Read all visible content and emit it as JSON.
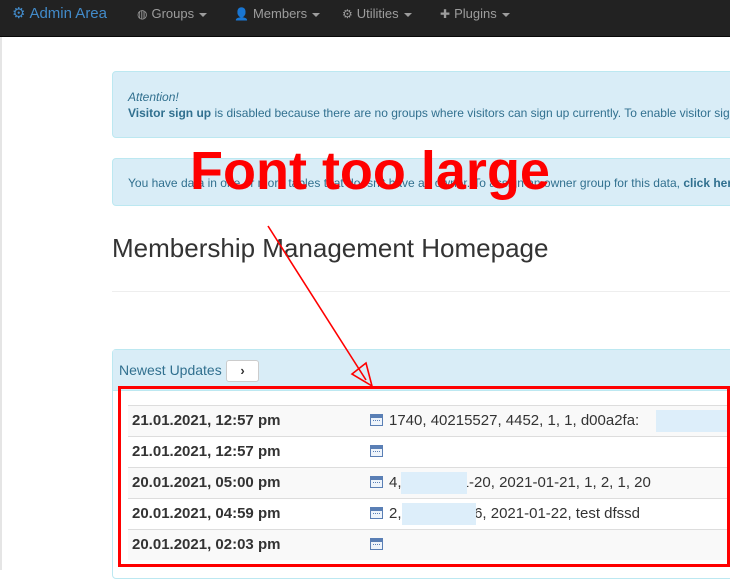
{
  "navbar": {
    "brand": "Admin Area",
    "items": [
      {
        "label": "Groups",
        "icon": "globe-icon"
      },
      {
        "label": "Members",
        "icon": "user-icon"
      },
      {
        "label": "Utilities",
        "icon": "cog-icon"
      },
      {
        "label": "Plugins",
        "icon": "plus-icon"
      }
    ]
  },
  "alerts": {
    "signup": {
      "heading": "Attention!",
      "bold": "Visitor sign up",
      "text": " is disabled because there are no groups where visitors can sign up currently. To enable visitor sig"
    },
    "ownerless": {
      "text": "You have data in one or more tables that doesn't have an owner. To assign an owner group for this data, ",
      "link": "click her"
    }
  },
  "page": {
    "title": "Membership Management Homepage"
  },
  "panel": {
    "title": "Newest Updates",
    "button_glyph": "›",
    "rows": [
      {
        "date": "21.01.2021, 12:57 pm",
        "text": "1740, 40215527, 4452, 1, 1, d00a2fa:"
      },
      {
        "date": "21.01.2021, 12:57 pm",
        "text": ""
      },
      {
        "date": "20.01.2021, 05:00 pm",
        "text": "4,              , 2021-01-20, 2021-01-21, 1, 2, 1, 20"
      },
      {
        "date": "20.01.2021, 04:59 pm",
        "text": "2,                 2021-01-16, 2021-01-22, test dfssd"
      },
      {
        "date": "20.01.2021, 02:03 pm",
        "text": ""
      }
    ]
  },
  "annotation": {
    "text": "Font too large",
    "color": "#ff0000"
  }
}
